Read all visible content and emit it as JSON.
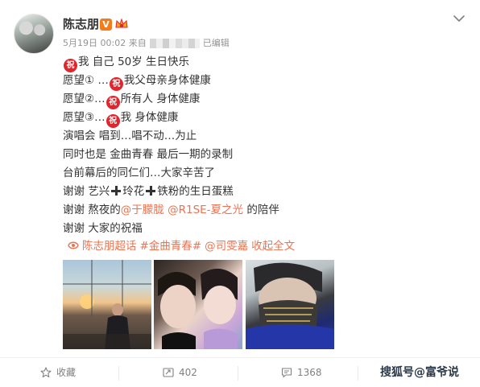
{
  "post": {
    "author": "陈志朋",
    "vip_badge": "V",
    "meta_date": "5月19日 00:02 来自",
    "meta_edited": "已编辑",
    "emoji_zhu": "祝",
    "lines": [
      {
        "parts": [
          {
            "t": "emoji"
          },
          {
            "t": "text",
            "v": "我 自己 50岁 生日快乐"
          }
        ]
      },
      {
        "parts": [
          {
            "t": "text",
            "v": "愿望① …"
          },
          {
            "t": "emoji"
          },
          {
            "t": "text",
            "v": "我父母亲身体健康"
          }
        ]
      },
      {
        "parts": [
          {
            "t": "text",
            "v": "愿望②…"
          },
          {
            "t": "emoji"
          },
          {
            "t": "text",
            "v": "所有人 身体健康"
          }
        ]
      },
      {
        "parts": [
          {
            "t": "text",
            "v": "愿望③…"
          },
          {
            "t": "emoji"
          },
          {
            "t": "text",
            "v": "我 身体健康"
          }
        ]
      },
      {
        "parts": [
          {
            "t": "text",
            "v": "演唱会 唱到…唱不动…为止"
          }
        ]
      },
      {
        "parts": [
          {
            "t": "text",
            "v": "同时也是 金曲青春 最后一期的录制"
          }
        ]
      },
      {
        "parts": [
          {
            "t": "text",
            "v": "台前幕后的同仁们…大家辛苦了"
          }
        ]
      },
      {
        "parts": [
          {
            "t": "text",
            "v": "谢谢 艺兴"
          },
          {
            "t": "plus"
          },
          {
            "t": "text",
            "v": "玲花"
          },
          {
            "t": "plus"
          },
          {
            "t": "text",
            "v": "铁粉的生日蛋糕"
          }
        ]
      },
      {
        "parts": [
          {
            "t": "text",
            "v": "谢谢 熬夜的"
          },
          {
            "t": "mention",
            "v": "@于朦胧"
          },
          {
            "t": "text",
            "v": " "
          },
          {
            "t": "mention",
            "v": "@R1SE-夏之光"
          },
          {
            "t": "text",
            "v": " 的陪伴"
          }
        ]
      },
      {
        "parts": [
          {
            "t": "text",
            "v": "谢谢 大家的祝福"
          }
        ]
      }
    ],
    "topics": [
      "陈志朋超话",
      "#金曲青春#",
      "@司雯嘉",
      "收起全文"
    ]
  },
  "actions": {
    "favorite_label": "收藏",
    "repost_count": "402",
    "comment_count": "1368"
  },
  "watermark": "搜狐号@富爷说",
  "colors": {
    "accent": "#eb7350",
    "zhu_red": "#e0262c",
    "vip_orange": "#f47d1b"
  }
}
